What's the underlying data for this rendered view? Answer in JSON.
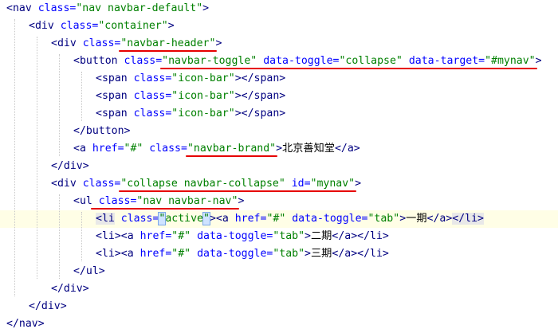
{
  "editor": {
    "lines": [
      {
        "indent": 0,
        "segments": [
          {
            "text": "<",
            "k": "t"
          },
          {
            "text": "nav",
            "k": "t"
          },
          {
            "text": " class=",
            "k": "a"
          },
          {
            "text": "\"nav navbar-default\"",
            "k": "v"
          },
          {
            "text": ">",
            "k": "t"
          }
        ]
      },
      {
        "indent": 1,
        "segments": [
          {
            "text": "<div",
            "k": "t"
          },
          {
            "text": " class=",
            "k": "a"
          },
          {
            "text": "\"container\"",
            "k": "v"
          },
          {
            "text": ">",
            "k": "t"
          }
        ]
      },
      {
        "indent": 2,
        "segments": [
          {
            "text": "<div",
            "k": "t"
          },
          {
            "text": " class=",
            "k": "a"
          },
          {
            "text": "\"navbar-header\"",
            "k": "v"
          },
          {
            "text": ">",
            "k": "t"
          }
        ]
      },
      {
        "indent": 3,
        "segments": [
          {
            "text": "<button",
            "k": "t"
          },
          {
            "text": " class=",
            "k": "a"
          },
          {
            "text": "\"navbar-toggle\"",
            "k": "v"
          },
          {
            "text": " data-toggle=",
            "k": "a"
          },
          {
            "text": "\"collapse\"",
            "k": "v"
          },
          {
            "text": " data-target=",
            "k": "a"
          },
          {
            "text": "\"#mynav\"",
            "k": "v"
          },
          {
            "text": ">",
            "k": "t"
          }
        ]
      },
      {
        "indent": 4,
        "segments": [
          {
            "text": "<span",
            "k": "t"
          },
          {
            "text": " class=",
            "k": "a"
          },
          {
            "text": "\"icon-bar\"",
            "k": "v"
          },
          {
            "text": "></span>",
            "k": "t"
          }
        ]
      },
      {
        "indent": 4,
        "segments": [
          {
            "text": "<span",
            "k": "t"
          },
          {
            "text": " class=",
            "k": "a"
          },
          {
            "text": "\"icon-bar\"",
            "k": "v"
          },
          {
            "text": "></span>",
            "k": "t"
          }
        ]
      },
      {
        "indent": 4,
        "segments": [
          {
            "text": "<span",
            "k": "t"
          },
          {
            "text": " class=",
            "k": "a"
          },
          {
            "text": "\"icon-bar\"",
            "k": "v"
          },
          {
            "text": "></span>",
            "k": "t"
          }
        ]
      },
      {
        "indent": 3,
        "segments": [
          {
            "text": "</button>",
            "k": "t"
          }
        ]
      },
      {
        "indent": 3,
        "segments": [
          {
            "text": "<a",
            "k": "t"
          },
          {
            "text": " href=",
            "k": "a"
          },
          {
            "text": "\"#\"",
            "k": "v"
          },
          {
            "text": " class=",
            "k": "a"
          },
          {
            "text": "\"navbar-brand\"",
            "k": "v"
          },
          {
            "text": ">",
            "k": "t"
          },
          {
            "text": "北京善知堂",
            "k": "tx"
          },
          {
            "text": "</a>",
            "k": "t"
          }
        ]
      },
      {
        "indent": 2,
        "segments": [
          {
            "text": "</div>",
            "k": "t"
          }
        ]
      },
      {
        "indent": 2,
        "segments": [
          {
            "text": "<div",
            "k": "t"
          },
          {
            "text": " class=",
            "k": "a"
          },
          {
            "text": "\"collapse navbar-collapse\"",
            "k": "v"
          },
          {
            "text": " id=",
            "k": "a"
          },
          {
            "text": "\"mynav\"",
            "k": "v"
          },
          {
            "text": ">",
            "k": "t"
          }
        ]
      },
      {
        "indent": 3,
        "segments": [
          {
            "text": "<ul",
            "k": "t"
          },
          {
            "text": " class=",
            "k": "a"
          },
          {
            "text": "\"nav navbar-nav\"",
            "k": "v"
          },
          {
            "text": ">",
            "k": "t"
          }
        ]
      },
      {
        "indent": 4,
        "current": true,
        "segments": [
          {
            "text": "<li",
            "k": "t",
            "hl": true
          },
          {
            "text": " class=",
            "k": "a"
          },
          {
            "text": "\"",
            "k": "v",
            "cursor": true
          },
          {
            "text": "active",
            "k": "v"
          },
          {
            "text": "\"",
            "k": "v",
            "cursor": true
          },
          {
            "text": ">",
            "k": "t"
          },
          {
            "text": "<a",
            "k": "t"
          },
          {
            "text": " href=",
            "k": "a"
          },
          {
            "text": "\"#\"",
            "k": "v"
          },
          {
            "text": " data-toggle=",
            "k": "a"
          },
          {
            "text": "\"tab\"",
            "k": "v"
          },
          {
            "text": ">",
            "k": "t"
          },
          {
            "text": "一期",
            "k": "tx"
          },
          {
            "text": "</a>",
            "k": "t"
          },
          {
            "text": "</li>",
            "k": "t",
            "hl": true
          }
        ]
      },
      {
        "indent": 4,
        "segments": [
          {
            "text": "<li>",
            "k": "t"
          },
          {
            "text": "<a",
            "k": "t"
          },
          {
            "text": " href=",
            "k": "a"
          },
          {
            "text": "\"#\"",
            "k": "v"
          },
          {
            "text": " data-toggle=",
            "k": "a"
          },
          {
            "text": "\"tab\"",
            "k": "v"
          },
          {
            "text": ">",
            "k": "t"
          },
          {
            "text": "二期",
            "k": "tx"
          },
          {
            "text": "</a></li>",
            "k": "t"
          }
        ]
      },
      {
        "indent": 4,
        "segments": [
          {
            "text": "<li>",
            "k": "t"
          },
          {
            "text": "<a",
            "k": "t"
          },
          {
            "text": " href=",
            "k": "a"
          },
          {
            "text": "\"#\"",
            "k": "v"
          },
          {
            "text": " data-toggle=",
            "k": "a"
          },
          {
            "text": "\"tab\"",
            "k": "v"
          },
          {
            "text": ">",
            "k": "t"
          },
          {
            "text": "三期",
            "k": "tx"
          },
          {
            "text": "</a></li>",
            "k": "t"
          }
        ]
      },
      {
        "indent": 3,
        "segments": [
          {
            "text": "</ul>",
            "k": "t"
          }
        ]
      },
      {
        "indent": 2,
        "segments": [
          {
            "text": "</div>",
            "k": "t"
          }
        ]
      },
      {
        "indent": 1,
        "segments": [
          {
            "text": "</div>",
            "k": "t"
          }
        ]
      },
      {
        "indent": 0,
        "segments": [
          {
            "text": "</nav>",
            "k": "t"
          }
        ]
      }
    ]
  }
}
